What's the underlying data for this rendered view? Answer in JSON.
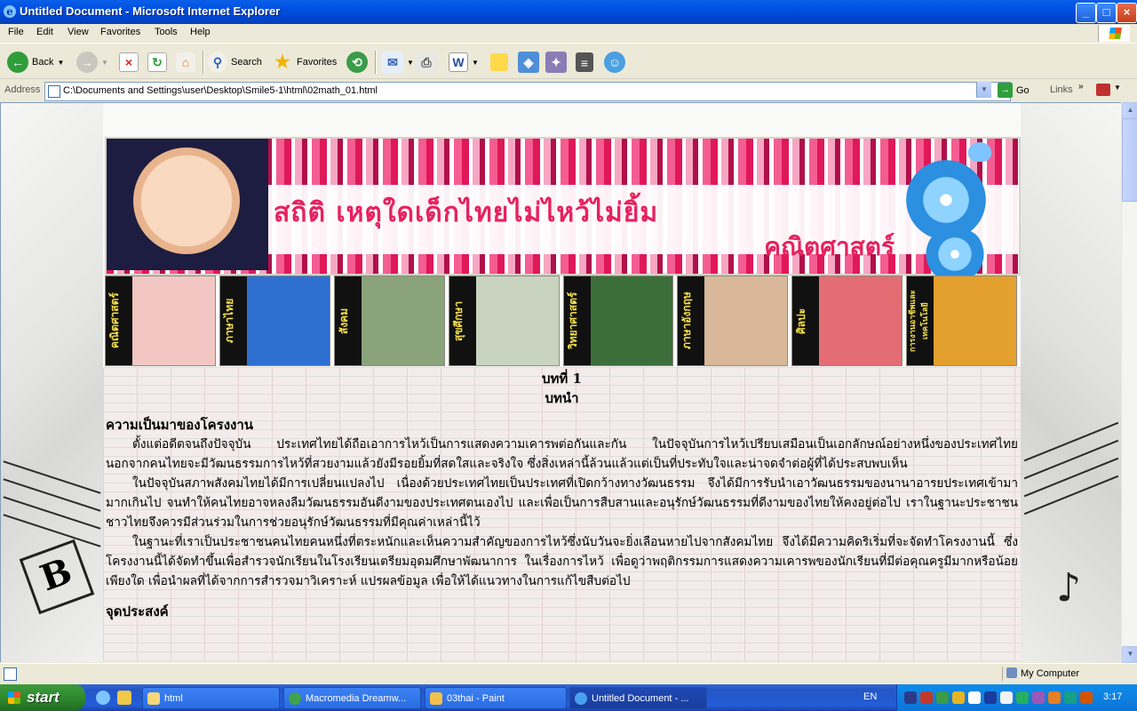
{
  "window": {
    "title": "Untitled Document - Microsoft Internet Explorer",
    "controls": {
      "minimize": "_",
      "maximize": "□",
      "close": "×"
    }
  },
  "menu": [
    "File",
    "Edit",
    "View",
    "Favorites",
    "Tools",
    "Help"
  ],
  "toolbar": {
    "back_label": "Back",
    "search_label": "Search",
    "favorites_label": "Favorites"
  },
  "address": {
    "label": "Address",
    "value": "C:\\Documents and Settings\\user\\Desktop\\Smile5-1\\html\\02math_01.html",
    "go_label": "Go",
    "links_label": "Links"
  },
  "banner": {
    "headline": "สถิติ  เหตุใดเด็กไทยไม่ไหว้ไม่ยิ้ม",
    "subject": "คณิตศาสตร์"
  },
  "subjects": [
    {
      "label": "คณิตศาสตร์",
      "color": "#f2c7c3"
    },
    {
      "label": "ภาษาไทย",
      "color": "#2f6fd0"
    },
    {
      "label": "สังคม",
      "color": "#8aa37a"
    },
    {
      "label": "สุขศึกษา",
      "color": "#c9d4c0"
    },
    {
      "label": "วิทยาศาสตร์",
      "color": "#3c6e3a"
    },
    {
      "label": "ภาษาอังกฤษ",
      "color": "#d9b89a"
    },
    {
      "label": "ศิลปะ",
      "color": "#e36d73"
    },
    {
      "label": "การงานอาชีพและเทคโนโลยี",
      "color": "#e3a02e"
    }
  ],
  "article": {
    "chapter": "บทที่ 1",
    "chapter_title": "บทนำ",
    "section1_heading": "ความเป็นมาของโครงงาน",
    "para1": "ตั้งแต่อดีตจนถึงปัจจุบัน  ประเทศไทยได้ถือเอาการไหว้เป็นการแสดงความเคารพต่อกันและกัน  ในปัจจุบันการไหว้เปรียบเสมือนเป็นเอกลักษณ์อย่างหนึ่งของประเทศไทย  นอกจากคนไทยจะมีวัฒนธรรมการไหว้ที่สวยงามแล้วยังมีรอยยิ้มที่สดใสและจริงใจ  ซึ่งสิ่งเหล่านี้ล้วนแล้วแต่เป็นที่ประทับใจและน่าจดจำต่อผู้ที่ได้ประสบพบเห็น",
    "para2": "ในปัจจุบันสภาพสังคมไทยได้มีการเปลี่ยนแปลงไป  เนื่องด้วยประเทศไทยเป็นประเทศที่เปิดกว้างทางวัฒนธรรม  จึงได้มีการรับนำเอาวัฒนธรรมของนานาอารยประเทศเข้ามามากเกินไป  จนทำให้คนไทยอาจหลงลืมวัฒนธรรมอันดีงามของประเทศตนเองไป  และเพื่อเป็นการสืบสานและอนุรักษ์วัฒนธรรมที่ดีงามของไทยให้คงอยู่ต่อไป  เราในฐานะประชาชนชาวไทยจึงควรมีส่วนร่วมในการช่วยอนุรักษ์วัฒนธรรมที่มีคุณค่าเหล่านี้ไว้",
    "para3": "ในฐานะที่เราเป็นประชาชนคนไทยคนหนึ่งที่ตระหนักและเห็นความสำคัญของการไหว้ซึ่งนับวันจะยิ่งเลือนหายไปจากสังคมไทย  จึงได้มีความคิดริเริ่มที่จะจัดทำโครงงานนี้  ซึ่งโครงงานนี้ได้จัดทำขึ้นเพื่อสำรวจนักเรียนในโรงเรียนเตรียมอุดมศึกษาพัฒนาการ  ในเรื่องการไหว้ เพื่อดูว่าพฤติกรรมการแสดงความเคารพของนักเรียนที่มีต่อคุณครูมีมากหรือน้อยเพียงใด  เพื่อนำผลที่ได้จากการสำรวจมาวิเคราะห์  แปรผลข้อมูล  เพื่อให้ได้แนวทางในการแก้ไขสืบต่อไป",
    "section2_heading": "จุดประสงค์"
  },
  "status": {
    "zone": "My Computer"
  },
  "taskbar": {
    "start_label": "start",
    "tasks": [
      {
        "label": "html",
        "color": "#f5d77a"
      },
      {
        "label": "Macromedia Dreamw...",
        "color": "#3fa34d"
      },
      {
        "label": "03thai - Paint",
        "color": "#f1c14b"
      },
      {
        "label": "Untitled Document - ...",
        "color": "#4aa0f0"
      }
    ],
    "lang": "EN",
    "clock": "3:17"
  }
}
